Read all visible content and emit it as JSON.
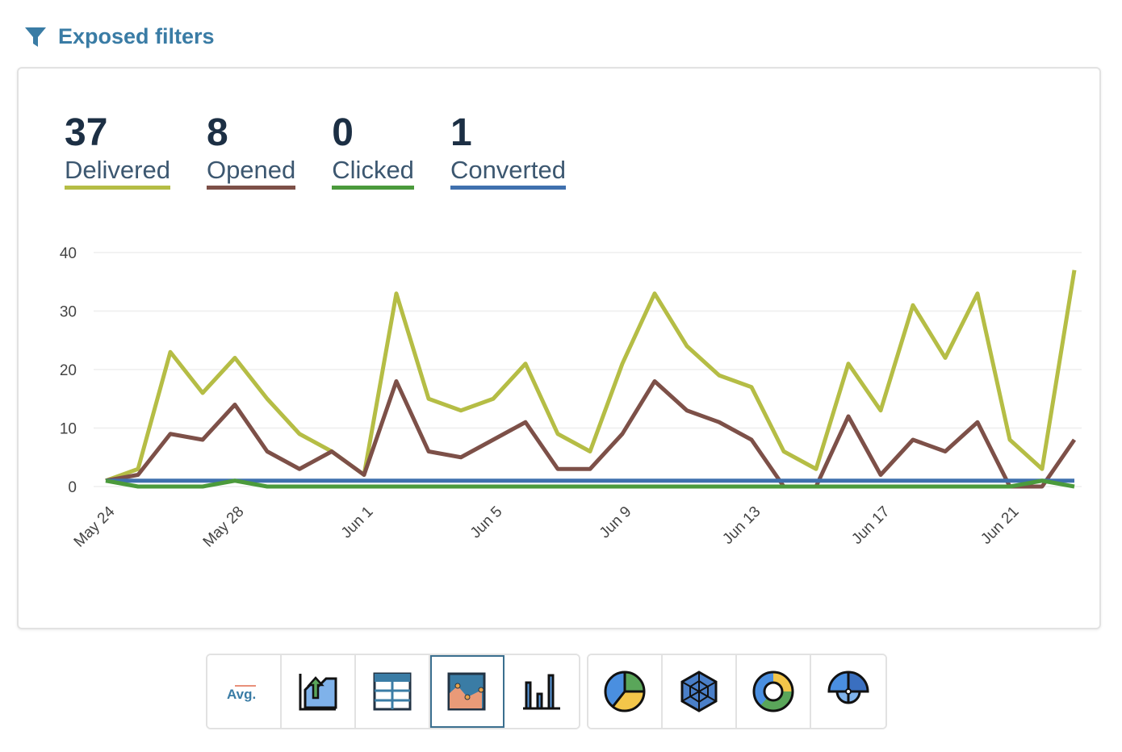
{
  "header": {
    "title": "Exposed filters",
    "icon": "filter-icon"
  },
  "stats": [
    {
      "value": "37",
      "label": "Delivered",
      "color": "#b5bd45"
    },
    {
      "value": "8",
      "label": "Opened",
      "color": "#7d5048"
    },
    {
      "value": "0",
      "label": "Clicked",
      "color": "#4b9a3c"
    },
    {
      "value": "1",
      "label": "Converted",
      "color": "#3f70ae"
    }
  ],
  "chart_data": {
    "type": "line",
    "x": [
      "May 24",
      "May 25",
      "May 26",
      "May 27",
      "May 28",
      "May 29",
      "May 30",
      "May 31",
      "Jun 1",
      "Jun 2",
      "Jun 3",
      "Jun 4",
      "Jun 5",
      "Jun 6",
      "Jun 7",
      "Jun 8",
      "Jun 9",
      "Jun 10",
      "Jun 11",
      "Jun 12",
      "Jun 13",
      "Jun 14",
      "Jun 15",
      "Jun 16",
      "Jun 17",
      "Jun 18",
      "Jun 19",
      "Jun 20",
      "Jun 21",
      "Jun 22",
      "Jun 23"
    ],
    "x_tick_labels": [
      "May 24",
      "May 28",
      "Jun 1",
      "Jun 5",
      "Jun 9",
      "Jun 13",
      "Jun 17",
      "Jun 21"
    ],
    "y_tick_labels": [
      "0",
      "10",
      "20",
      "30",
      "40"
    ],
    "ylim": [
      0,
      40
    ],
    "grid": true,
    "series": [
      {
        "name": "Delivered",
        "color": "#b5bd45",
        "values": [
          1,
          3,
          23,
          16,
          22,
          15,
          9,
          6,
          2,
          33,
          15,
          13,
          15,
          21,
          9,
          6,
          21,
          33,
          24,
          19,
          17,
          6,
          3,
          21,
          13,
          31,
          22,
          33,
          8,
          3,
          37
        ]
      },
      {
        "name": "Opened",
        "color": "#7d5048",
        "values": [
          1,
          2,
          9,
          8,
          14,
          6,
          3,
          6,
          2,
          18,
          6,
          5,
          8,
          11,
          3,
          3,
          9,
          18,
          13,
          11,
          8,
          0,
          0,
          12,
          2,
          8,
          6,
          11,
          0,
          0,
          8
        ]
      },
      {
        "name": "Converted",
        "color": "#3f70ae",
        "values": [
          1,
          1,
          1,
          1,
          1,
          1,
          1,
          1,
          1,
          1,
          1,
          1,
          1,
          1,
          1,
          1,
          1,
          1,
          1,
          1,
          1,
          1,
          1,
          1,
          1,
          1,
          1,
          1,
          1,
          1,
          1
        ]
      },
      {
        "name": "Clicked",
        "color": "#4b9a3c",
        "values": [
          1,
          0,
          0,
          0,
          1,
          0,
          0,
          0,
          0,
          0,
          0,
          0,
          0,
          0,
          0,
          0,
          0,
          0,
          0,
          0,
          0,
          0,
          0,
          0,
          0,
          0,
          0,
          0,
          0,
          1,
          0
        ]
      }
    ]
  },
  "toolbar": {
    "groups": [
      [
        {
          "name": "average",
          "label": "Avg.",
          "icon": "avg-icon"
        },
        {
          "name": "trend",
          "icon": "trend-chart-icon"
        },
        {
          "name": "table",
          "icon": "table-icon"
        },
        {
          "name": "area",
          "icon": "area-chart-icon",
          "active": true
        },
        {
          "name": "bar",
          "icon": "bar-chart-icon"
        }
      ],
      [
        {
          "name": "pie",
          "icon": "pie-chart-icon"
        },
        {
          "name": "radar",
          "icon": "radar-chart-icon"
        },
        {
          "name": "donut",
          "icon": "donut-chart-icon"
        },
        {
          "name": "polar",
          "icon": "polar-chart-icon"
        }
      ]
    ]
  }
}
